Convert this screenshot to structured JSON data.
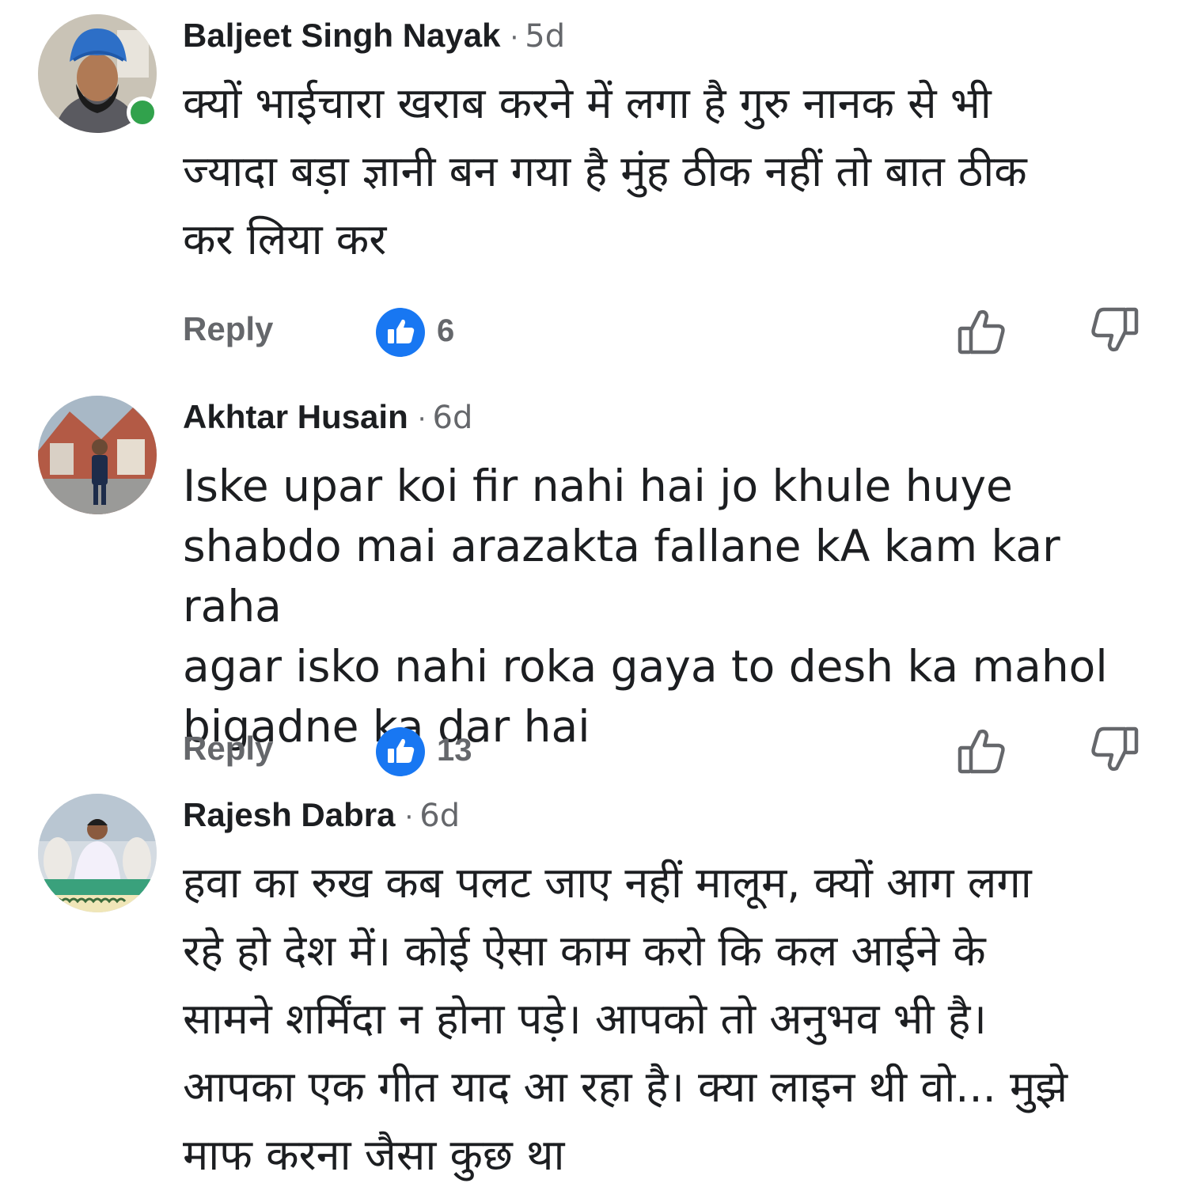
{
  "comments": [
    {
      "author": "Baljeet Singh Nayak",
      "separator": "·",
      "time": "5d",
      "online": true,
      "text_lines": [
        "क्यों भाईचारा खराब करने में लगा है गुरु नानक से भी",
        "ज्यादा बड़ा ज्ञानी बन गया है  मुंह ठीक नहीं तो बात ठीक",
        "कर लिया कर"
      ],
      "reply_label": "Reply",
      "like_count": "6"
    },
    {
      "author": "Akhtar Husain",
      "separator": "·",
      "time": "6d",
      "online": false,
      "text_lines": [
        "Iske upar koi fir nahi hai jo khule huye",
        "shabdo mai arazakta fallane kA kam kar raha",
        "agar isko nahi roka gaya to desh ka mahol",
        "bigadne ka dar hai"
      ],
      "reply_label": "Reply",
      "like_count": "13"
    },
    {
      "author": "Rajesh Dabra",
      "separator": "·",
      "time": "6d",
      "online": false,
      "text_lines": [
        "हवा का रुख कब पलट जाए नहीं मालूम, क्यों आग लगा",
        "रहे हो देश में। कोई ऐसा काम करो कि कल आईने के",
        "सामने शर्मिंदा न होना पड़े। आपको तो अनुभव भी है।",
        "आपका एक गीत याद आ रहा है। क्या लाइन थी वो... मुझे",
        "माफ करना जैसा कुछ था"
      ]
    }
  ],
  "icons": {
    "reaction": "like-reaction-icon",
    "like": "thumbs-up-outline-icon",
    "dislike": "thumbs-down-outline-icon"
  },
  "colors": {
    "text": "#1c1e21",
    "secondary": "#65676b",
    "like_blue": "#1877f2",
    "online_green": "#31a24c"
  }
}
